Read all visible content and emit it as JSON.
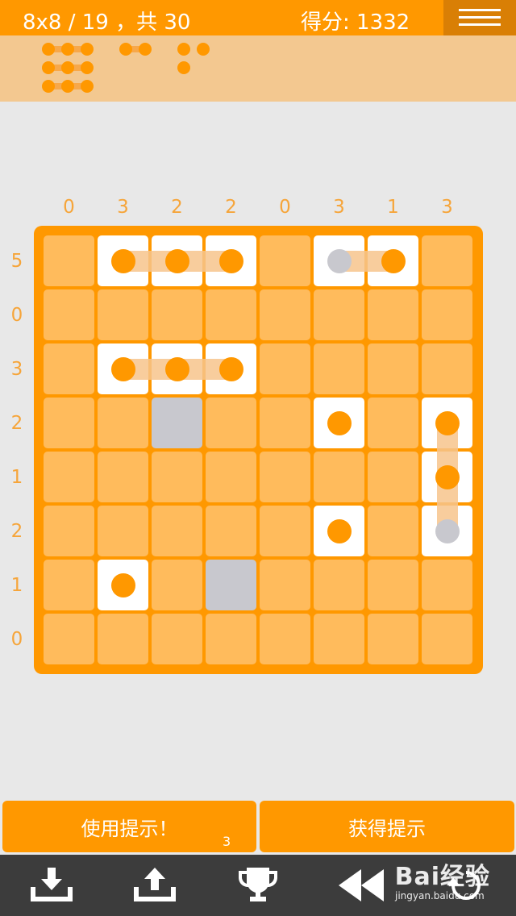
{
  "header": {
    "level": "8x8 / 19 ，共 30",
    "score": "得分: 1332"
  },
  "ship_legend": [
    {
      "size": 3,
      "count": 3
    },
    {
      "size": 2,
      "count": 1
    },
    {
      "size": 1,
      "count": 3
    }
  ],
  "puzzle": {
    "column_clues": [
      "0",
      "3",
      "2",
      "2",
      "0",
      "3",
      "1",
      "3"
    ],
    "row_clues": [
      "5",
      "0",
      "3",
      "2",
      "1",
      "2",
      "1",
      "0"
    ],
    "ship_cells": [
      [
        0,
        1
      ],
      [
        0,
        2
      ],
      [
        0,
        3
      ],
      [
        0,
        5
      ],
      [
        0,
        6
      ],
      [
        2,
        1
      ],
      [
        2,
        2
      ],
      [
        2,
        3
      ],
      [
        3,
        5
      ],
      [
        3,
        7
      ],
      [
        4,
        7
      ],
      [
        5,
        5
      ],
      [
        5,
        7
      ],
      [
        6,
        1
      ]
    ],
    "water_cells": [
      [
        3,
        2
      ],
      [
        6,
        3
      ]
    ],
    "dots": [
      {
        "r": 0,
        "c": 1,
        "color": "orange"
      },
      {
        "r": 0,
        "c": 2,
        "color": "orange"
      },
      {
        "r": 0,
        "c": 3,
        "color": "orange"
      },
      {
        "r": 0,
        "c": 5,
        "color": "grey"
      },
      {
        "r": 0,
        "c": 6,
        "color": "orange"
      },
      {
        "r": 2,
        "c": 1,
        "color": "orange"
      },
      {
        "r": 2,
        "c": 2,
        "color": "orange"
      },
      {
        "r": 2,
        "c": 3,
        "color": "orange"
      },
      {
        "r": 3,
        "c": 5,
        "color": "orange"
      },
      {
        "r": 3,
        "c": 7,
        "color": "orange"
      },
      {
        "r": 4,
        "c": 7,
        "color": "orange"
      },
      {
        "r": 5,
        "c": 5,
        "color": "orange"
      },
      {
        "r": 5,
        "c": 7,
        "color": "grey"
      },
      {
        "r": 6,
        "c": 1,
        "color": "orange"
      }
    ],
    "ships": [
      {
        "r": 0,
        "c1": 1,
        "c2": 3,
        "dir": "h"
      },
      {
        "r": 0,
        "c1": 5,
        "c2": 6,
        "dir": "h"
      },
      {
        "r": 2,
        "c1": 1,
        "c2": 3,
        "dir": "h"
      },
      {
        "c": 7,
        "r1": 3,
        "r2": 5,
        "dir": "v"
      }
    ]
  },
  "buttons": {
    "use_hint": "使用提示！",
    "hint_count": "3",
    "get_hints": "获得提示"
  },
  "toolbar_icons": [
    "download-icon",
    "upload-icon",
    "trophy-icon",
    "rewind-icon",
    "undo-icon"
  ],
  "watermark": {
    "logo": "Bai经验",
    "url": "jingyan.baidu.com"
  },
  "colors": {
    "accent": "#ff9800",
    "cell_empty": "#ffbb5c",
    "cell_ship": "#ffffff",
    "cell_water": "#c8c8ce",
    "toolbar": "#3c3c3c"
  }
}
